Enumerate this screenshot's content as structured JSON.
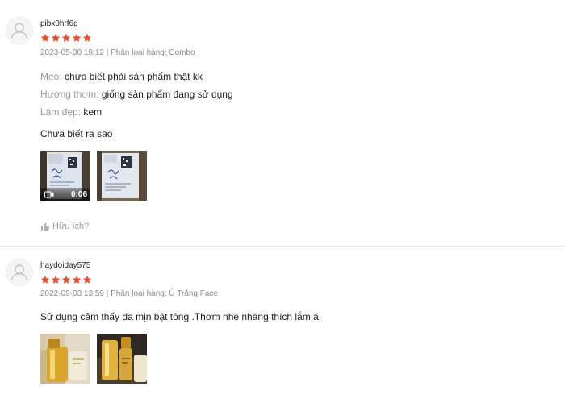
{
  "accent_color": "#ee4d2d",
  "reviews": [
    {
      "username": "pibx0hrf6g",
      "rating": 5,
      "meta": "2023-05-30 19:12 | Phân loại hàng: Combo",
      "attributes": [
        {
          "label": "Meo:",
          "value": "chưa biết phải sản phẩm thật kk"
        },
        {
          "label": "Hương thơm:",
          "value": "giống sản phẩm đang sử dụng"
        },
        {
          "label": "Làm đẹp:",
          "value": "kem"
        }
      ],
      "text": "Chưa biết ra sao",
      "media": [
        {
          "kind": "video",
          "duration": "0:06",
          "icon": "video-camera-icon"
        },
        {
          "kind": "image"
        }
      ],
      "helpful_label": "Hữu ích?",
      "helpful_icon": "thumbs-up-icon"
    },
    {
      "username": "haydoiday575",
      "rating": 5,
      "meta": "2022-09-03 13:59 | Phân loại hàng: Ủ Trắng Face",
      "text": "Sử dụng cảm thấy da mịn bật tông .Thơm nhẹ nhàng thích lắm á.",
      "media": [
        {
          "kind": "image"
        },
        {
          "kind": "image"
        }
      ]
    }
  ]
}
